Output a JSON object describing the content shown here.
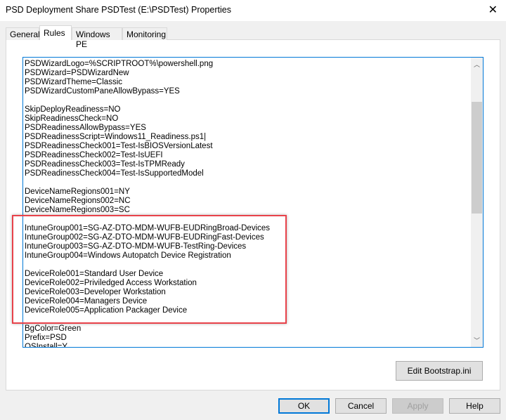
{
  "window": {
    "title": "PSD Deployment Share PSDTest (E:\\PSDTest) Properties",
    "close_glyph": "✕"
  },
  "tabs": [
    {
      "label": "General"
    },
    {
      "label": "Rules",
      "active": true
    },
    {
      "label": "Windows PE"
    },
    {
      "label": "Monitoring"
    }
  ],
  "rules_text": [
    "PSDWizardLogo=%SCRIPTROOT%\\powershell.png",
    "PSDWizard=PSDWizardNew",
    "PSDWizardTheme=Classic",
    "PSDWizardCustomPaneAllowBypass=YES",
    "",
    "SkipDeployReadiness=NO",
    "SkipReadinessCheck=NO",
    "PSDReadinessAllowBypass=YES",
    "PSDReadinessScript=Windows11_Readiness.ps1|",
    "PSDReadinessCheck001=Test-IsBIOSVersionLatest",
    "PSDReadinessCheck002=Test-IsUEFI",
    "PSDReadinessCheck003=Test-IsTPMReady",
    "PSDReadinessCheck004=Test-IsSupportedModel",
    "",
    "DeviceNameRegions001=NY",
    "DeviceNameRegions002=NC",
    "DeviceNameRegions003=SC",
    "",
    "IntuneGroup001=SG-AZ-DTO-MDM-WUFB-EUDRingBroad-Devices",
    "IntuneGroup002=SG-AZ-DTO-MDM-WUFB-EUDRingFast-Devices",
    "IntuneGroup003=SG-AZ-DTO-MDM-WUFB-TestRing-Devices",
    "IntuneGroup004=Windows Autopatch Device Registration",
    "",
    "DeviceRole001=Standard User Device",
    "DeviceRole002=Priviledged Access Workstation",
    "DeviceRole003=Developer Workstation",
    "DeviceRole004=Managers Device",
    "DeviceRole005=Application Packager Device",
    "",
    "BgColor=Green",
    "Prefix=PSD",
    "OSInstall=Y"
  ],
  "highlight_color": "#e8424a",
  "buttons": {
    "edit_bootstrap": "Edit Bootstrap.ini",
    "ok": "OK",
    "cancel": "Cancel",
    "apply": "Apply",
    "help": "Help"
  }
}
